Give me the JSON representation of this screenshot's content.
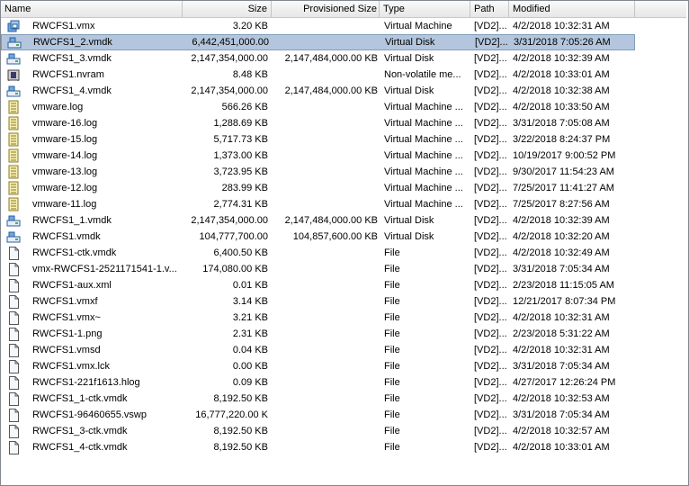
{
  "columns": {
    "name": "Name",
    "size": "Size",
    "provisioned": "Provisioned Size",
    "type": "Type",
    "path": "Path",
    "modified": "Modified"
  },
  "selected_index": 1,
  "colors": {
    "selection": "#b4c6dd",
    "selection_border": "#7f9db9"
  },
  "files": [
    {
      "icon": "vm-icon",
      "name": "RWCFS1.vmx",
      "size": "3.20 KB",
      "provisioned": "",
      "type": "Virtual Machine",
      "path": "[VD2]...",
      "modified": "4/2/2018 10:32:31 AM"
    },
    {
      "icon": "virtual-disk-icon",
      "name": "RWCFS1_2.vmdk",
      "size": "6,442,451,000.00",
      "provisioned": "",
      "type": "Virtual Disk",
      "path": "[VD2]...",
      "modified": "3/31/2018 7:05:26 AM"
    },
    {
      "icon": "virtual-disk-icon",
      "name": "RWCFS1_3.vmdk",
      "size": "2,147,354,000.00",
      "provisioned": "2,147,484,000.00 KB",
      "type": "Virtual Disk",
      "path": "[VD2]...",
      "modified": "4/2/2018 10:32:39 AM"
    },
    {
      "icon": "nvram-icon",
      "name": "RWCFS1.nvram",
      "size": "8.48 KB",
      "provisioned": "",
      "type": "Non-volatile me...",
      "path": "[VD2]...",
      "modified": "4/2/2018 10:33:01 AM"
    },
    {
      "icon": "virtual-disk-icon",
      "name": "RWCFS1_4.vmdk",
      "size": "2,147,354,000.00",
      "provisioned": "2,147,484,000.00 KB",
      "type": "Virtual Disk",
      "path": "[VD2]...",
      "modified": "4/2/2018 10:32:38 AM"
    },
    {
      "icon": "log-icon",
      "name": "vmware.log",
      "size": "566.26 KB",
      "provisioned": "",
      "type": "Virtual Machine ...",
      "path": "[VD2]...",
      "modified": "4/2/2018 10:33:50 AM"
    },
    {
      "icon": "log-icon",
      "name": "vmware-16.log",
      "size": "1,288.69 KB",
      "provisioned": "",
      "type": "Virtual Machine ...",
      "path": "[VD2]...",
      "modified": "3/31/2018 7:05:08 AM"
    },
    {
      "icon": "log-icon",
      "name": "vmware-15.log",
      "size": "5,717.73 KB",
      "provisioned": "",
      "type": "Virtual Machine ...",
      "path": "[VD2]...",
      "modified": "3/22/2018 8:24:37 PM"
    },
    {
      "icon": "log-icon",
      "name": "vmware-14.log",
      "size": "1,373.00 KB",
      "provisioned": "",
      "type": "Virtual Machine ...",
      "path": "[VD2]...",
      "modified": "10/19/2017 9:00:52 PM"
    },
    {
      "icon": "log-icon",
      "name": "vmware-13.log",
      "size": "3,723.95 KB",
      "provisioned": "",
      "type": "Virtual Machine ...",
      "path": "[VD2]...",
      "modified": "9/30/2017 11:54:23 AM"
    },
    {
      "icon": "log-icon",
      "name": "vmware-12.log",
      "size": "283.99 KB",
      "provisioned": "",
      "type": "Virtual Machine ...",
      "path": "[VD2]...",
      "modified": "7/25/2017 11:41:27 AM"
    },
    {
      "icon": "log-icon",
      "name": "vmware-11.log",
      "size": "2,774.31 KB",
      "provisioned": "",
      "type": "Virtual Machine ...",
      "path": "[VD2]...",
      "modified": "7/25/2017 8:27:56 AM"
    },
    {
      "icon": "virtual-disk-icon",
      "name": "RWCFS1_1.vmdk",
      "size": "2,147,354,000.00",
      "provisioned": "2,147,484,000.00 KB",
      "type": "Virtual Disk",
      "path": "[VD2]...",
      "modified": "4/2/2018 10:32:39 AM"
    },
    {
      "icon": "virtual-disk-icon",
      "name": "RWCFS1.vmdk",
      "size": "104,777,700.00",
      "provisioned": "104,857,600.00 KB",
      "type": "Virtual Disk",
      "path": "[VD2]...",
      "modified": "4/2/2018 10:32:20 AM"
    },
    {
      "icon": "file-icon",
      "name": "RWCFS1-ctk.vmdk",
      "size": "6,400.50 KB",
      "provisioned": "",
      "type": "File",
      "path": "[VD2]...",
      "modified": "4/2/2018 10:32:49 AM"
    },
    {
      "icon": "file-icon",
      "name": "vmx-RWCFS1-2521171541-1.v...",
      "size": "174,080.00 KB",
      "provisioned": "",
      "type": "File",
      "path": "[VD2]...",
      "modified": "3/31/2018 7:05:34 AM"
    },
    {
      "icon": "file-icon",
      "name": "RWCFS1-aux.xml",
      "size": "0.01 KB",
      "provisioned": "",
      "type": "File",
      "path": "[VD2]...",
      "modified": "2/23/2018 11:15:05 AM"
    },
    {
      "icon": "file-icon",
      "name": "RWCFS1.vmxf",
      "size": "3.14 KB",
      "provisioned": "",
      "type": "File",
      "path": "[VD2]...",
      "modified": "12/21/2017 8:07:34 PM"
    },
    {
      "icon": "file-icon",
      "name": "RWCFS1.vmx~",
      "size": "3.21 KB",
      "provisioned": "",
      "type": "File",
      "path": "[VD2]...",
      "modified": "4/2/2018 10:32:31 AM"
    },
    {
      "icon": "file-icon",
      "name": "RWCFS1-1.png",
      "size": "2.31 KB",
      "provisioned": "",
      "type": "File",
      "path": "[VD2]...",
      "modified": "2/23/2018 5:31:22 AM"
    },
    {
      "icon": "file-icon",
      "name": "RWCFS1.vmsd",
      "size": "0.04 KB",
      "provisioned": "",
      "type": "File",
      "path": "[VD2]...",
      "modified": "4/2/2018 10:32:31 AM"
    },
    {
      "icon": "file-icon",
      "name": "RWCFS1.vmx.lck",
      "size": "0.00 KB",
      "provisioned": "",
      "type": "File",
      "path": "[VD2]...",
      "modified": "3/31/2018 7:05:34 AM"
    },
    {
      "icon": "file-icon",
      "name": "RWCFS1-221f1613.hlog",
      "size": "0.09 KB",
      "provisioned": "",
      "type": "File",
      "path": "[VD2]...",
      "modified": "4/27/2017 12:26:24 PM"
    },
    {
      "icon": "file-icon",
      "name": "RWCFS1_1-ctk.vmdk",
      "size": "8,192.50 KB",
      "provisioned": "",
      "type": "File",
      "path": "[VD2]...",
      "modified": "4/2/2018 10:32:53 AM"
    },
    {
      "icon": "file-icon",
      "name": "RWCFS1-96460655.vswp",
      "size": "16,777,220.00 K",
      "provisioned": "",
      "type": "File",
      "path": "[VD2]...",
      "modified": "3/31/2018 7:05:34 AM"
    },
    {
      "icon": "file-icon",
      "name": "RWCFS1_3-ctk.vmdk",
      "size": "8,192.50 KB",
      "provisioned": "",
      "type": "File",
      "path": "[VD2]...",
      "modified": "4/2/2018 10:32:57 AM"
    },
    {
      "icon": "file-icon",
      "name": "RWCFS1_4-ctk.vmdk",
      "size": "8,192.50 KB",
      "provisioned": "",
      "type": "File",
      "path": "[VD2]...",
      "modified": "4/2/2018 10:33:01 AM"
    }
  ]
}
